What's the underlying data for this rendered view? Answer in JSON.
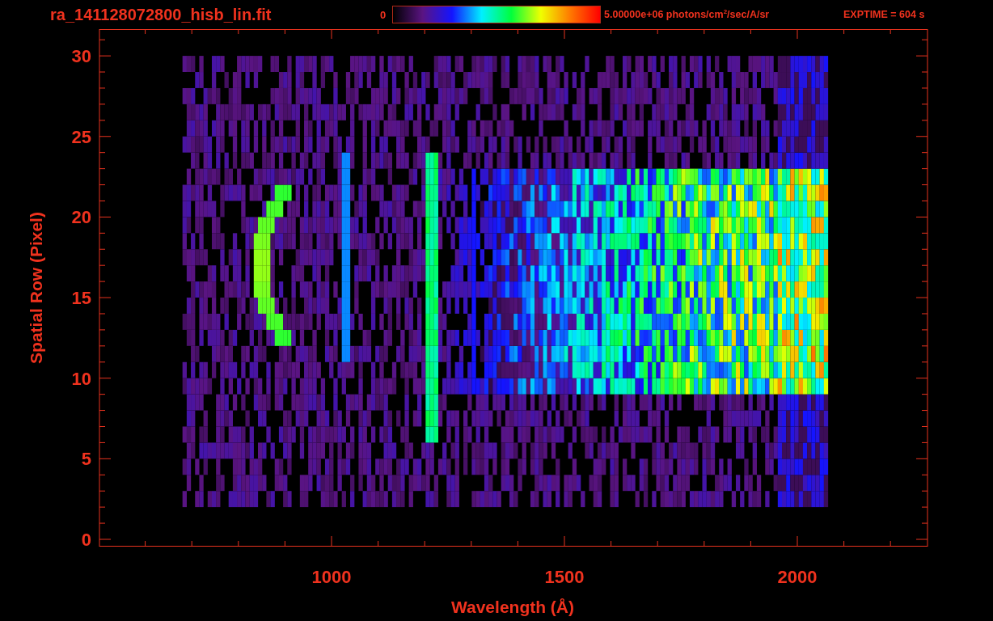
{
  "title": "ra_141128072800_hisb_lin.fit",
  "colorbar": {
    "min_label": "0",
    "max_label": "5.00000e+06 photons/cm$^{2}$/sec/A/sr"
  },
  "exposure": "EXPTIME = 604 s",
  "x_axis": {
    "label": "Wavelength (Å)",
    "tick_labels": [
      "1000",
      "1500",
      "2000"
    ]
  },
  "y_axis": {
    "label": "Spatial Row (Pixel)",
    "tick_labels": [
      "30",
      "25",
      "20",
      "15",
      "10",
      "5",
      "0"
    ]
  }
}
